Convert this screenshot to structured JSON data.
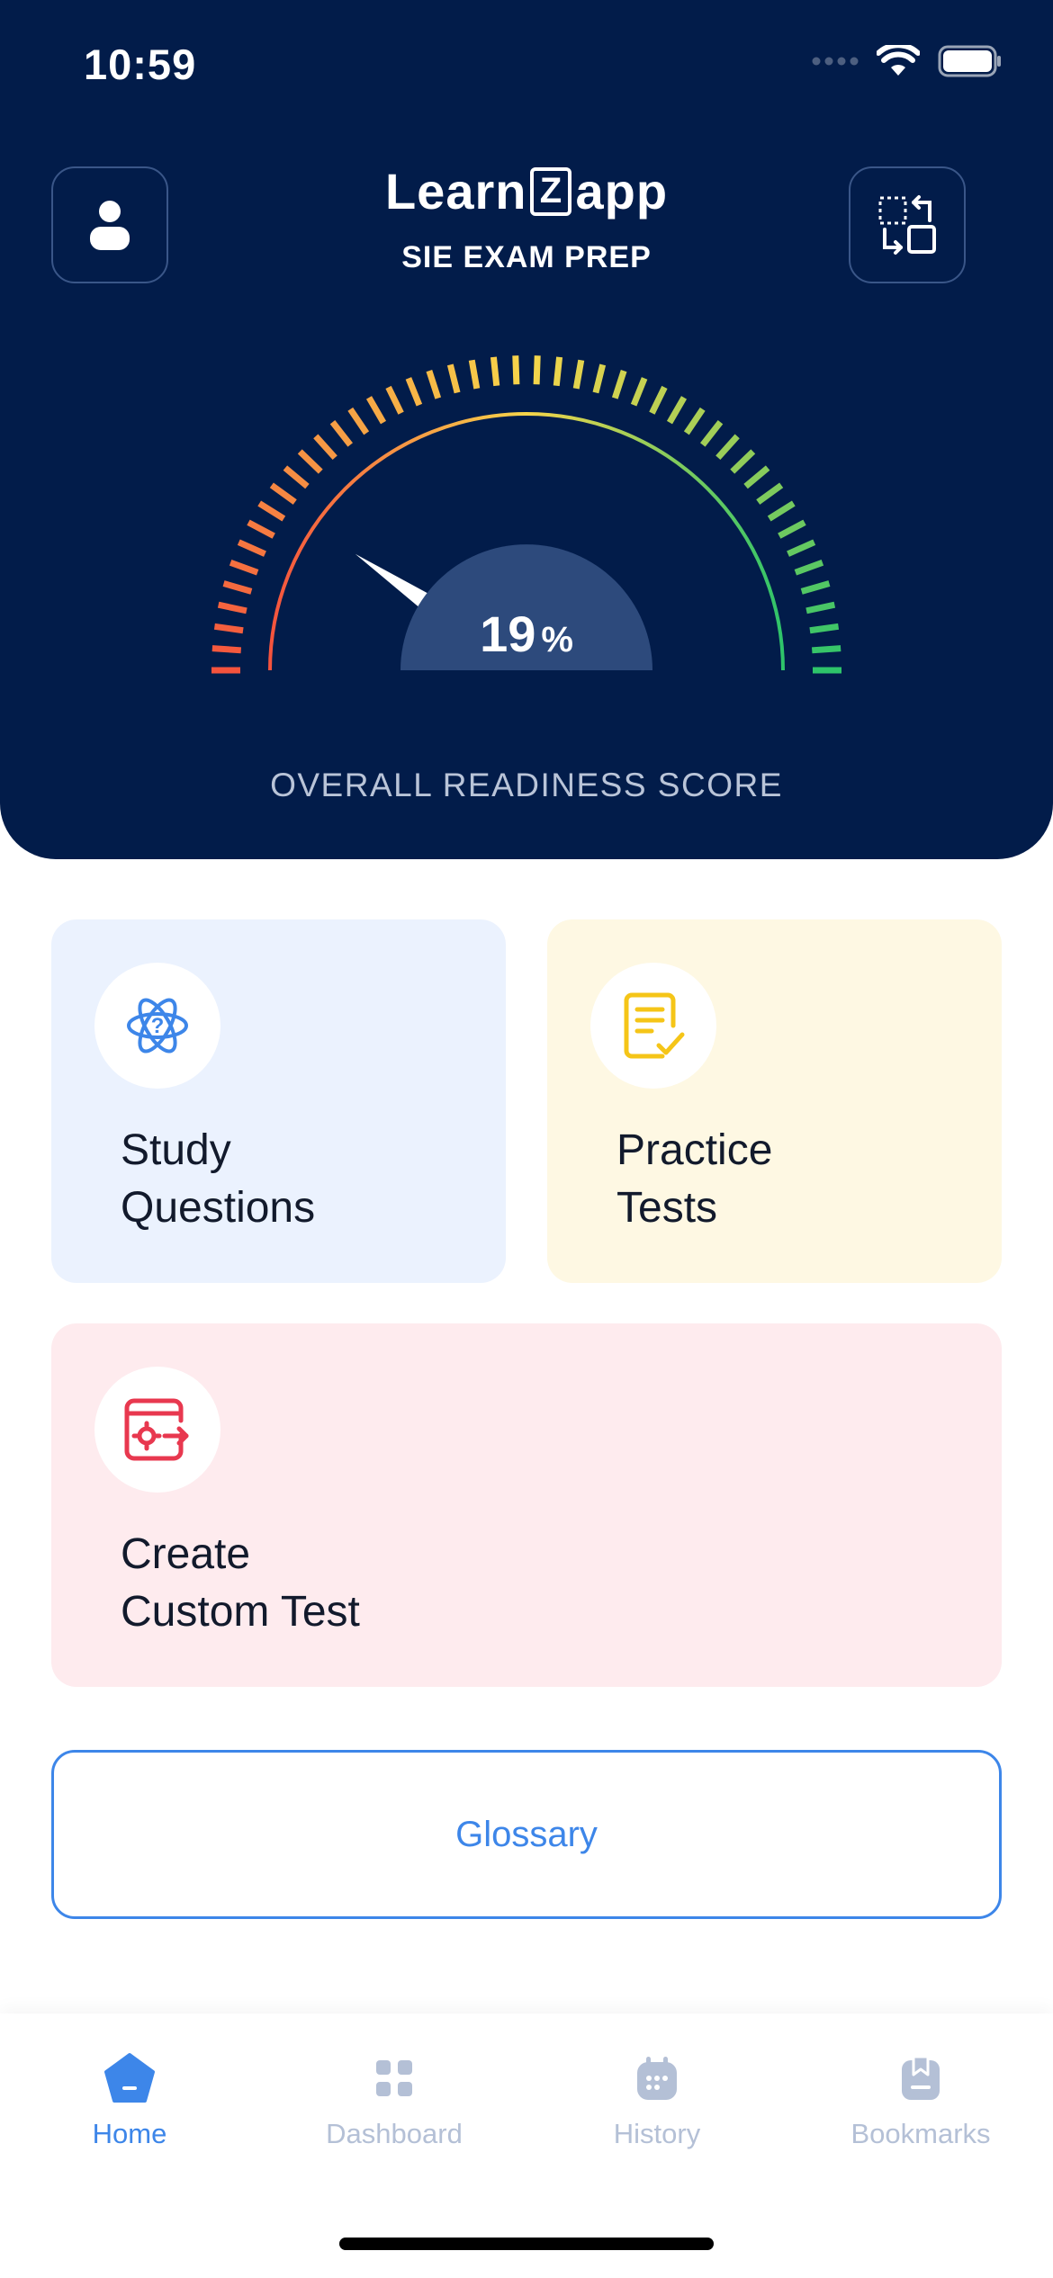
{
  "status_bar": {
    "time": "10:59",
    "signal_icon": "cellular-dots-icon",
    "wifi_icon": "wifi-icon",
    "battery_icon": "battery-icon"
  },
  "header": {
    "brand_prefix": "Learn",
    "brand_mark": "Z",
    "brand_suffix": "app",
    "subtitle": "SIE EXAM PREP",
    "profile_icon": "user-icon",
    "switch_icon": "switch-exam-icon"
  },
  "gauge": {
    "score_value": "19",
    "score_unit": "%",
    "score_fraction": 0.19,
    "label": "OVERALL READINESS SCORE",
    "colors": {
      "low": "#f5533d",
      "mid": "#f7d54a",
      "high": "#2ec46a",
      "hub": "#2d4a7c"
    }
  },
  "cards": {
    "study": {
      "line1": "Study",
      "line2": "Questions",
      "icon": "atom-question-icon",
      "bg": "#ebf2fe",
      "accent": "#3d86e9"
    },
    "practice": {
      "line1": "Practice",
      "line2": "Tests",
      "icon": "checklist-icon",
      "bg": "#fef8e3",
      "accent": "#f5c518"
    },
    "custom": {
      "line1": "Create",
      "line2": "Custom Test",
      "icon": "custom-test-icon",
      "bg": "#feebee",
      "accent": "#e8384f"
    }
  },
  "glossary": {
    "label": "Glossary"
  },
  "tabbar": {
    "tabs": [
      {
        "label": "Home",
        "icon": "home-icon",
        "active": true
      },
      {
        "label": "Dashboard",
        "icon": "dashboard-icon",
        "active": false
      },
      {
        "label": "History",
        "icon": "calendar-icon",
        "active": false
      },
      {
        "label": "Bookmarks",
        "icon": "bookmark-icon",
        "active": false
      }
    ]
  }
}
